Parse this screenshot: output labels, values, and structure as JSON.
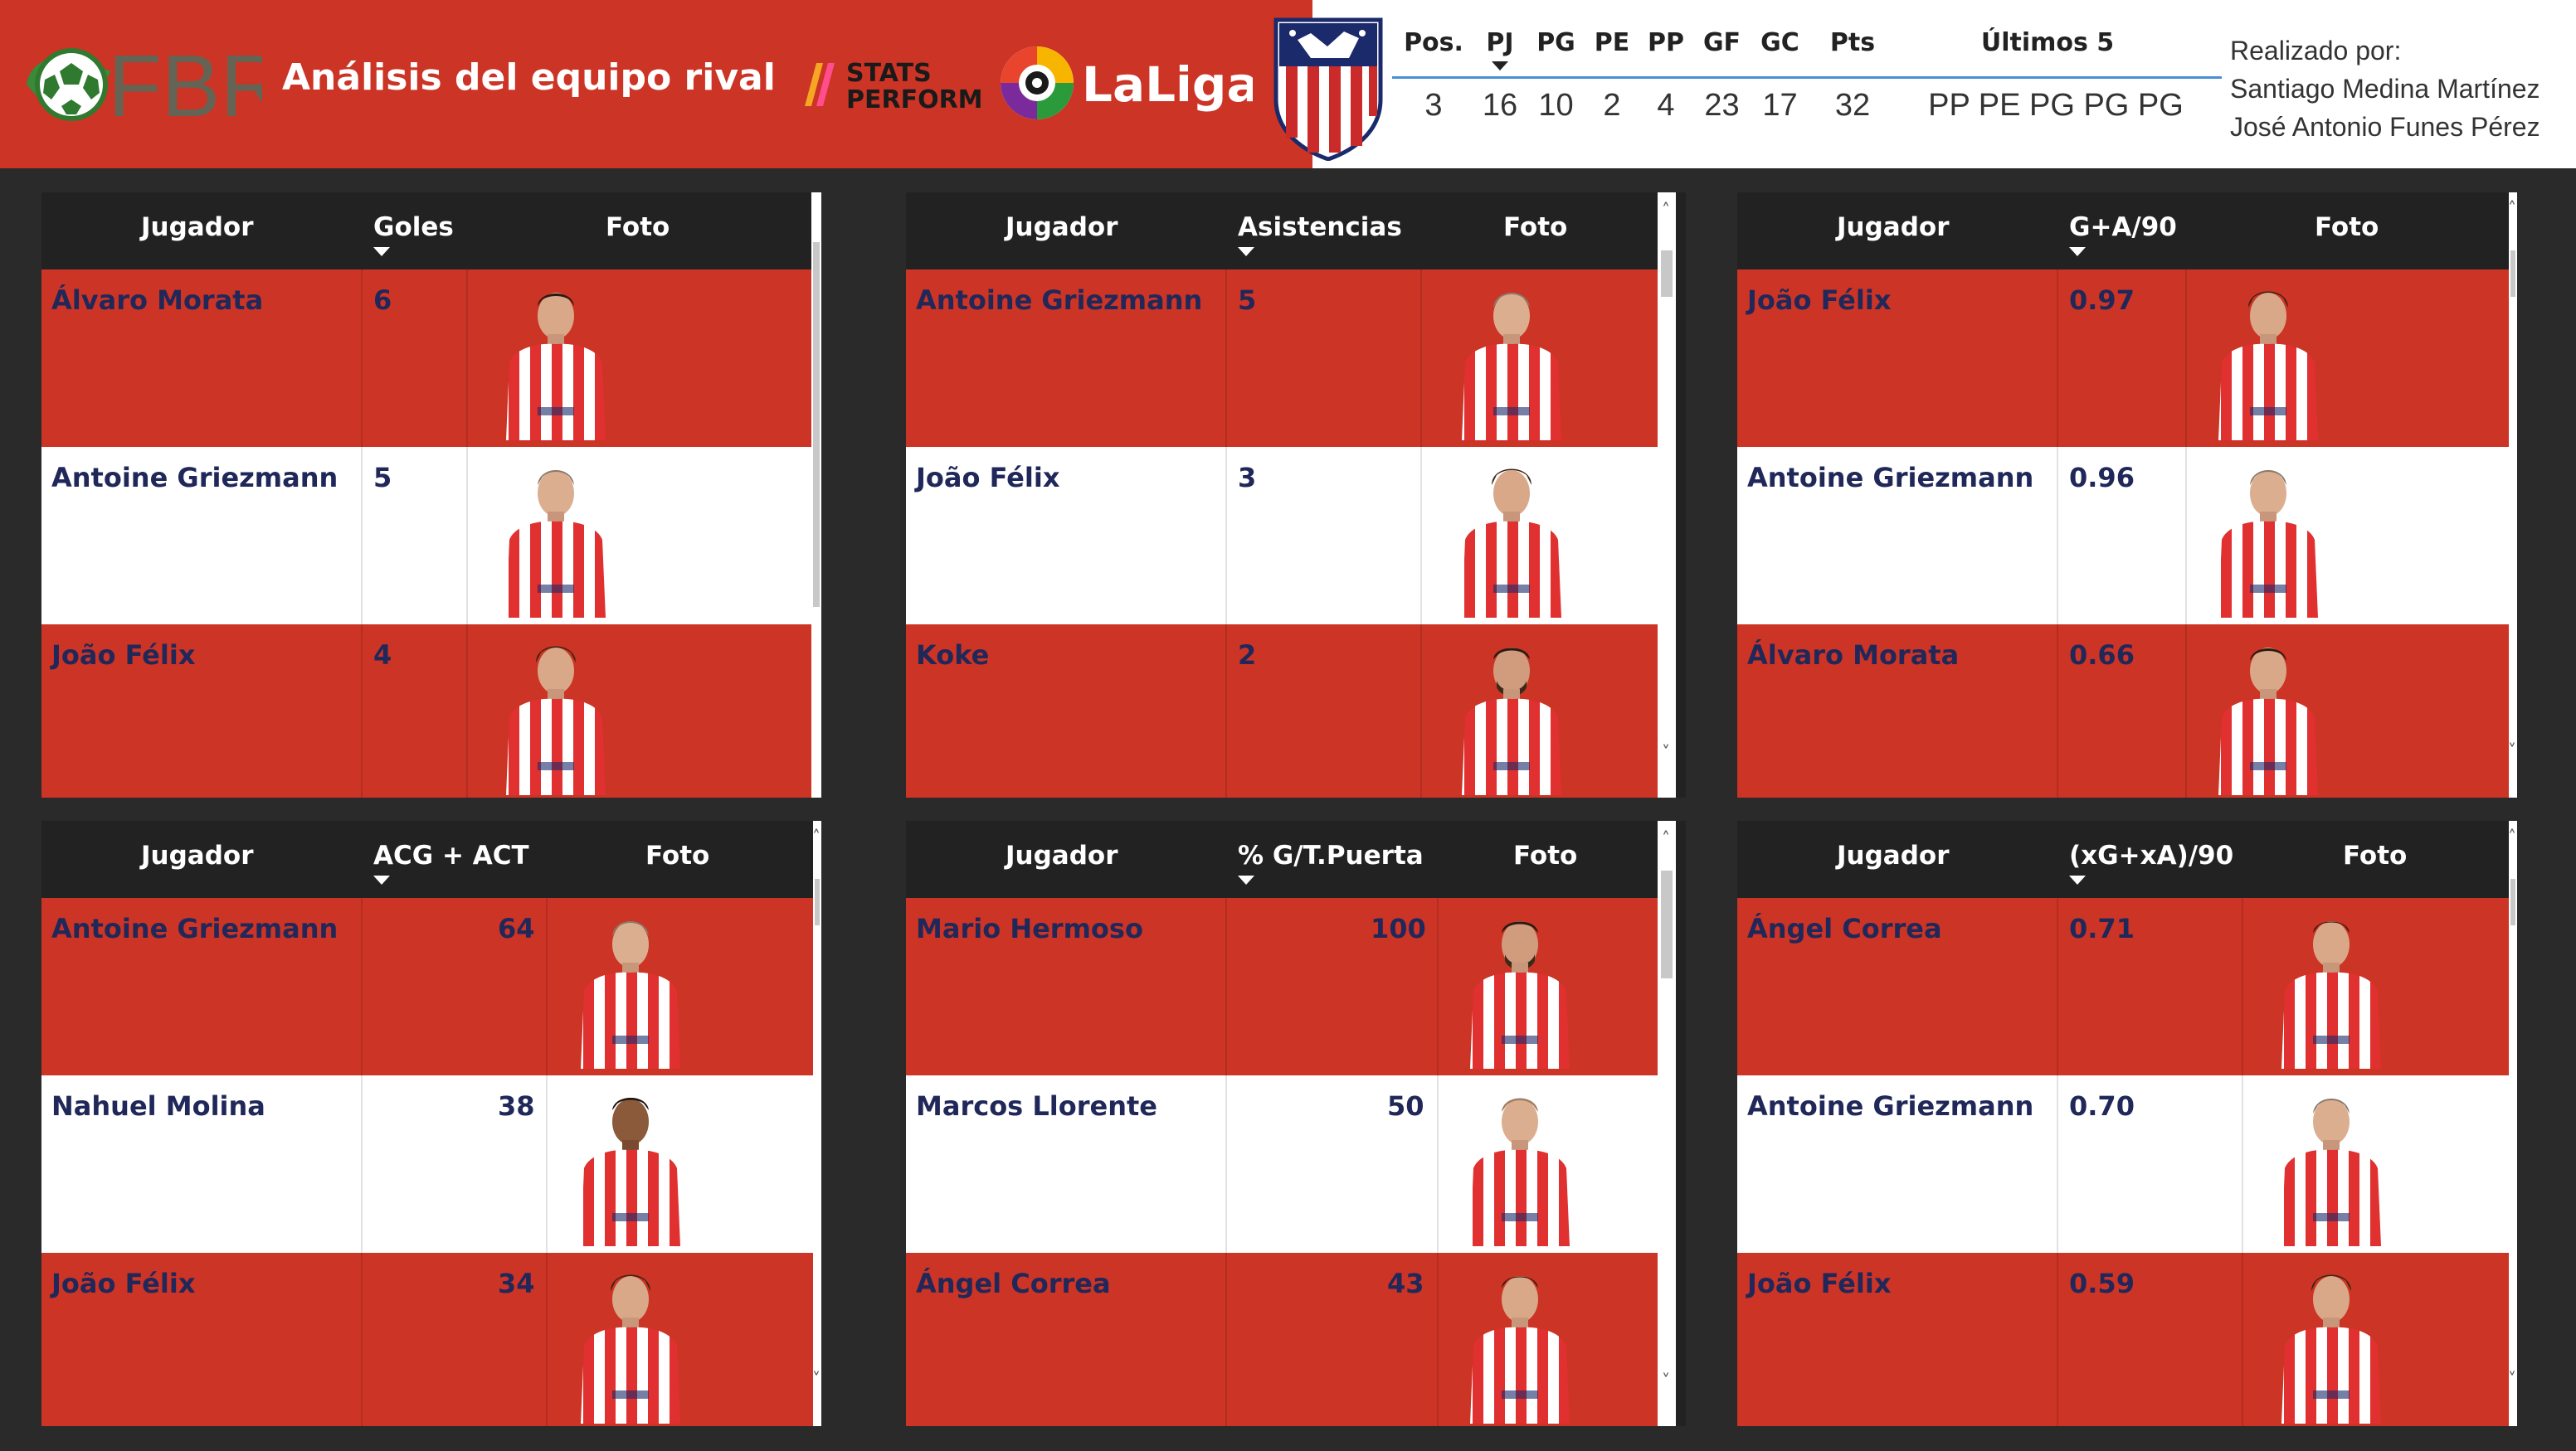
{
  "header": {
    "title": "Análisis del equipo rival",
    "logos": {
      "fbref_text": "FBREF",
      "stats_perform_line1": "STATS",
      "stats_perform_line2": "PERFORM",
      "laliga_text": "LaLiga"
    },
    "stats_columns": [
      "Pos.",
      "PJ",
      "PG",
      "PE",
      "PP",
      "GF",
      "GC",
      "Pts",
      "Últimos 5"
    ],
    "stats_values": [
      "3",
      "16",
      "10",
      "2",
      "4",
      "23",
      "17",
      "32",
      "PP PE PG PG PG"
    ],
    "credits_label": "Realizado por:",
    "credits_names": [
      "Santiago Medina Martínez",
      "José Antonio Funes Pérez"
    ]
  },
  "colors": {
    "red": "#cc3425",
    "dark": "#222222",
    "navy_text": "#20285a",
    "stats_divider": "#4a8fd4"
  },
  "panels": [
    {
      "headers": [
        "Jugador",
        "Goles",
        "Foto"
      ],
      "rows": [
        {
          "player": "Álvaro Morata",
          "value": "6",
          "photo": "player-photo"
        },
        {
          "player": "Antoine Griezmann",
          "value": "5",
          "photo": "player-photo"
        },
        {
          "player": "João Félix",
          "value": "4",
          "photo": "player-photo"
        }
      ]
    },
    {
      "headers": [
        "Jugador",
        "Asistencias",
        "Foto"
      ],
      "rows": [
        {
          "player": "Antoine Griezmann",
          "value": "5",
          "photo": "player-photo"
        },
        {
          "player": "João Félix",
          "value": "3",
          "photo": "player-photo"
        },
        {
          "player": "Koke",
          "value": "2",
          "photo": "player-photo"
        }
      ]
    },
    {
      "headers": [
        "Jugador",
        "G+A/90",
        "Foto"
      ],
      "rows": [
        {
          "player": "João Félix",
          "value": "0.97",
          "photo": "player-photo"
        },
        {
          "player": "Antoine Griezmann",
          "value": "0.96",
          "photo": "player-photo"
        },
        {
          "player": "Álvaro Morata",
          "value": "0.66",
          "photo": "player-photo"
        }
      ]
    },
    {
      "headers": [
        "Jugador",
        "ACG + ACT",
        "Foto"
      ],
      "rows": [
        {
          "player": "Antoine Griezmann",
          "value": "64",
          "photo": "player-photo"
        },
        {
          "player": "Nahuel Molina",
          "value": "38",
          "photo": "player-photo"
        },
        {
          "player": "João Félix",
          "value": "34",
          "photo": "player-photo"
        }
      ]
    },
    {
      "headers": [
        "Jugador",
        "% G/T.Puerta",
        "Foto"
      ],
      "rows": [
        {
          "player": "Mario Hermoso",
          "value": "100",
          "photo": "player-photo"
        },
        {
          "player": "Marcos Llorente",
          "value": "50",
          "photo": "player-photo"
        },
        {
          "player": "Ángel Correa",
          "value": "43",
          "photo": "player-photo"
        }
      ]
    },
    {
      "headers": [
        "Jugador",
        "(xG+xA)/90",
        "Foto"
      ],
      "rows": [
        {
          "player": "Ángel Correa",
          "value": "0.71",
          "photo": "player-photo"
        },
        {
          "player": "Antoine Griezmann",
          "value": "0.70",
          "photo": "player-photo"
        },
        {
          "player": "João Félix",
          "value": "0.59",
          "photo": "player-photo"
        }
      ]
    }
  ]
}
